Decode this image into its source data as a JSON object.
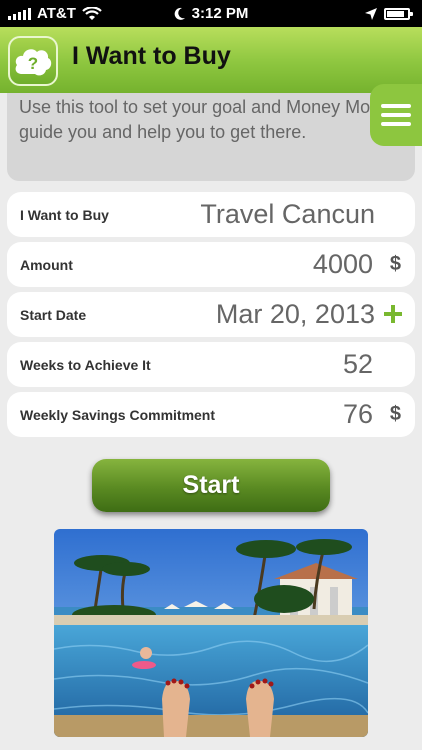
{
  "status_bar": {
    "carrier": "AT&T",
    "time": "3:12 PM"
  },
  "header": {
    "title": "I Want to Buy",
    "logo_glyph": "?"
  },
  "intro": {
    "text": "Use this tool to set your goal and Money Money will guide you and help you to get there."
  },
  "form": {
    "item": {
      "label": "I Want to Buy",
      "value": "Travel Cancun"
    },
    "amount": {
      "label": "Amount",
      "value": "4000",
      "unit": "$"
    },
    "start_date": {
      "label": "Start Date",
      "value": "Mar 20, 2013"
    },
    "weeks": {
      "label": "Weeks to Achieve It",
      "value": "52"
    },
    "weekly": {
      "label": "Weekly Savings Commitment",
      "value": "76",
      "unit": "$"
    }
  },
  "actions": {
    "start_label": "Start"
  },
  "colors": {
    "brand_green": "#8dc63f",
    "button_green": "#5a8a22",
    "plus_green": "#79b82f"
  }
}
